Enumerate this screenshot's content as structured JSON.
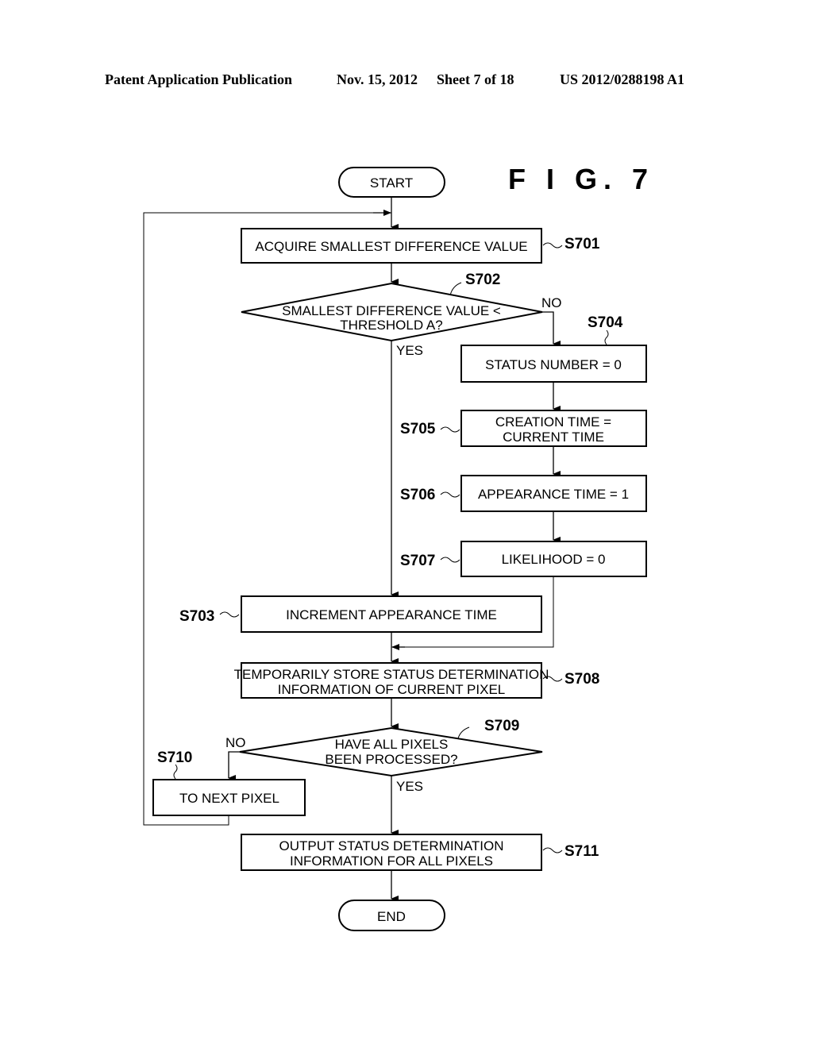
{
  "header": {
    "publication": "Patent Application Publication",
    "date": "Nov. 15, 2012",
    "sheet": "Sheet 7 of 18",
    "number": "US 2012/0288198 A1"
  },
  "figure": {
    "title": "F I G.  7"
  },
  "flowchart": {
    "start": "START",
    "end": "END",
    "steps": {
      "s701": {
        "id": "S701",
        "lines": [
          "ACQUIRE SMALLEST DIFFERENCE VALUE"
        ]
      },
      "s702": {
        "id": "S702",
        "lines": [
          "SMALLEST DIFFERENCE VALUE <",
          "THRESHOLD A?"
        ],
        "yes": "YES",
        "no": "NO"
      },
      "s703": {
        "id": "S703",
        "lines": [
          "INCREMENT APPEARANCE TIME"
        ]
      },
      "s704": {
        "id": "S704",
        "lines": [
          "STATUS NUMBER = 0"
        ]
      },
      "s705": {
        "id": "S705",
        "lines": [
          "CREATION TIME =",
          "CURRENT TIME"
        ]
      },
      "s706": {
        "id": "S706",
        "lines": [
          "APPEARANCE TIME = 1"
        ]
      },
      "s707": {
        "id": "S707",
        "lines": [
          "LIKELIHOOD = 0"
        ]
      },
      "s708": {
        "id": "S708",
        "lines": [
          "TEMPORARILY STORE STATUS DETERMINATION",
          "INFORMATION OF CURRENT PIXEL"
        ]
      },
      "s709": {
        "id": "S709",
        "lines": [
          "HAVE ALL PIXELS",
          "BEEN PROCESSED?"
        ],
        "yes": "YES",
        "no": "NO"
      },
      "s710": {
        "id": "S710",
        "lines": [
          "TO NEXT PIXEL"
        ]
      },
      "s711": {
        "id": "S711",
        "lines": [
          "OUTPUT STATUS DETERMINATION",
          "INFORMATION FOR ALL PIXELS"
        ]
      }
    }
  }
}
